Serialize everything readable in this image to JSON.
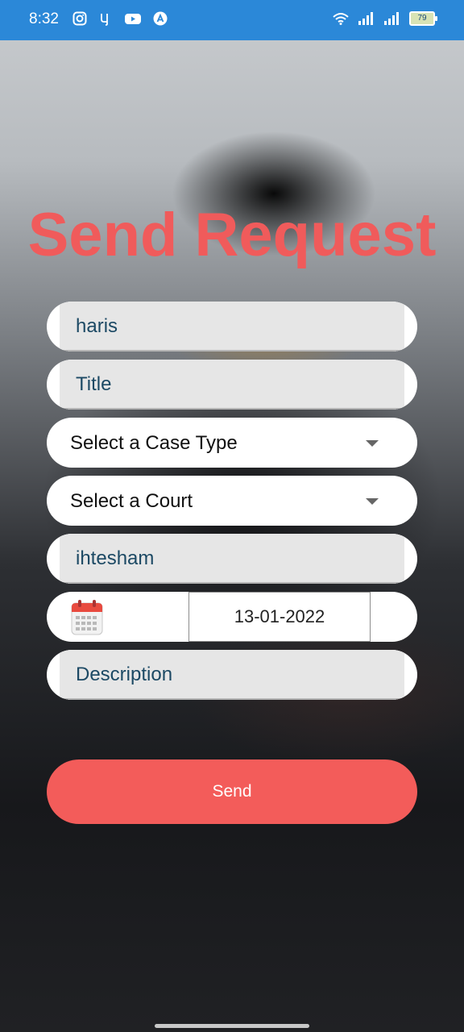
{
  "status_bar": {
    "time": "8:32",
    "battery": "79",
    "icons_left": [
      "instagram-icon",
      "y-app-icon",
      "youtube-icon",
      "arc-app-icon"
    ],
    "icons_right": [
      "wifi-icon",
      "signal-icon",
      "signal-icon",
      "battery-icon"
    ]
  },
  "page": {
    "title": "Send Request"
  },
  "form": {
    "name_value": "haris",
    "title_placeholder": "Title",
    "case_type_label": "Select a Case Type",
    "court_label": "Select a Court",
    "lawyer_value": "ihtesham",
    "date_value": "13-01-2022",
    "description_placeholder": "Description",
    "send_label": "Send"
  },
  "colors": {
    "accent": "#f05b5b",
    "status_bar": "#2b88d8",
    "field_text": "#1c4964"
  }
}
